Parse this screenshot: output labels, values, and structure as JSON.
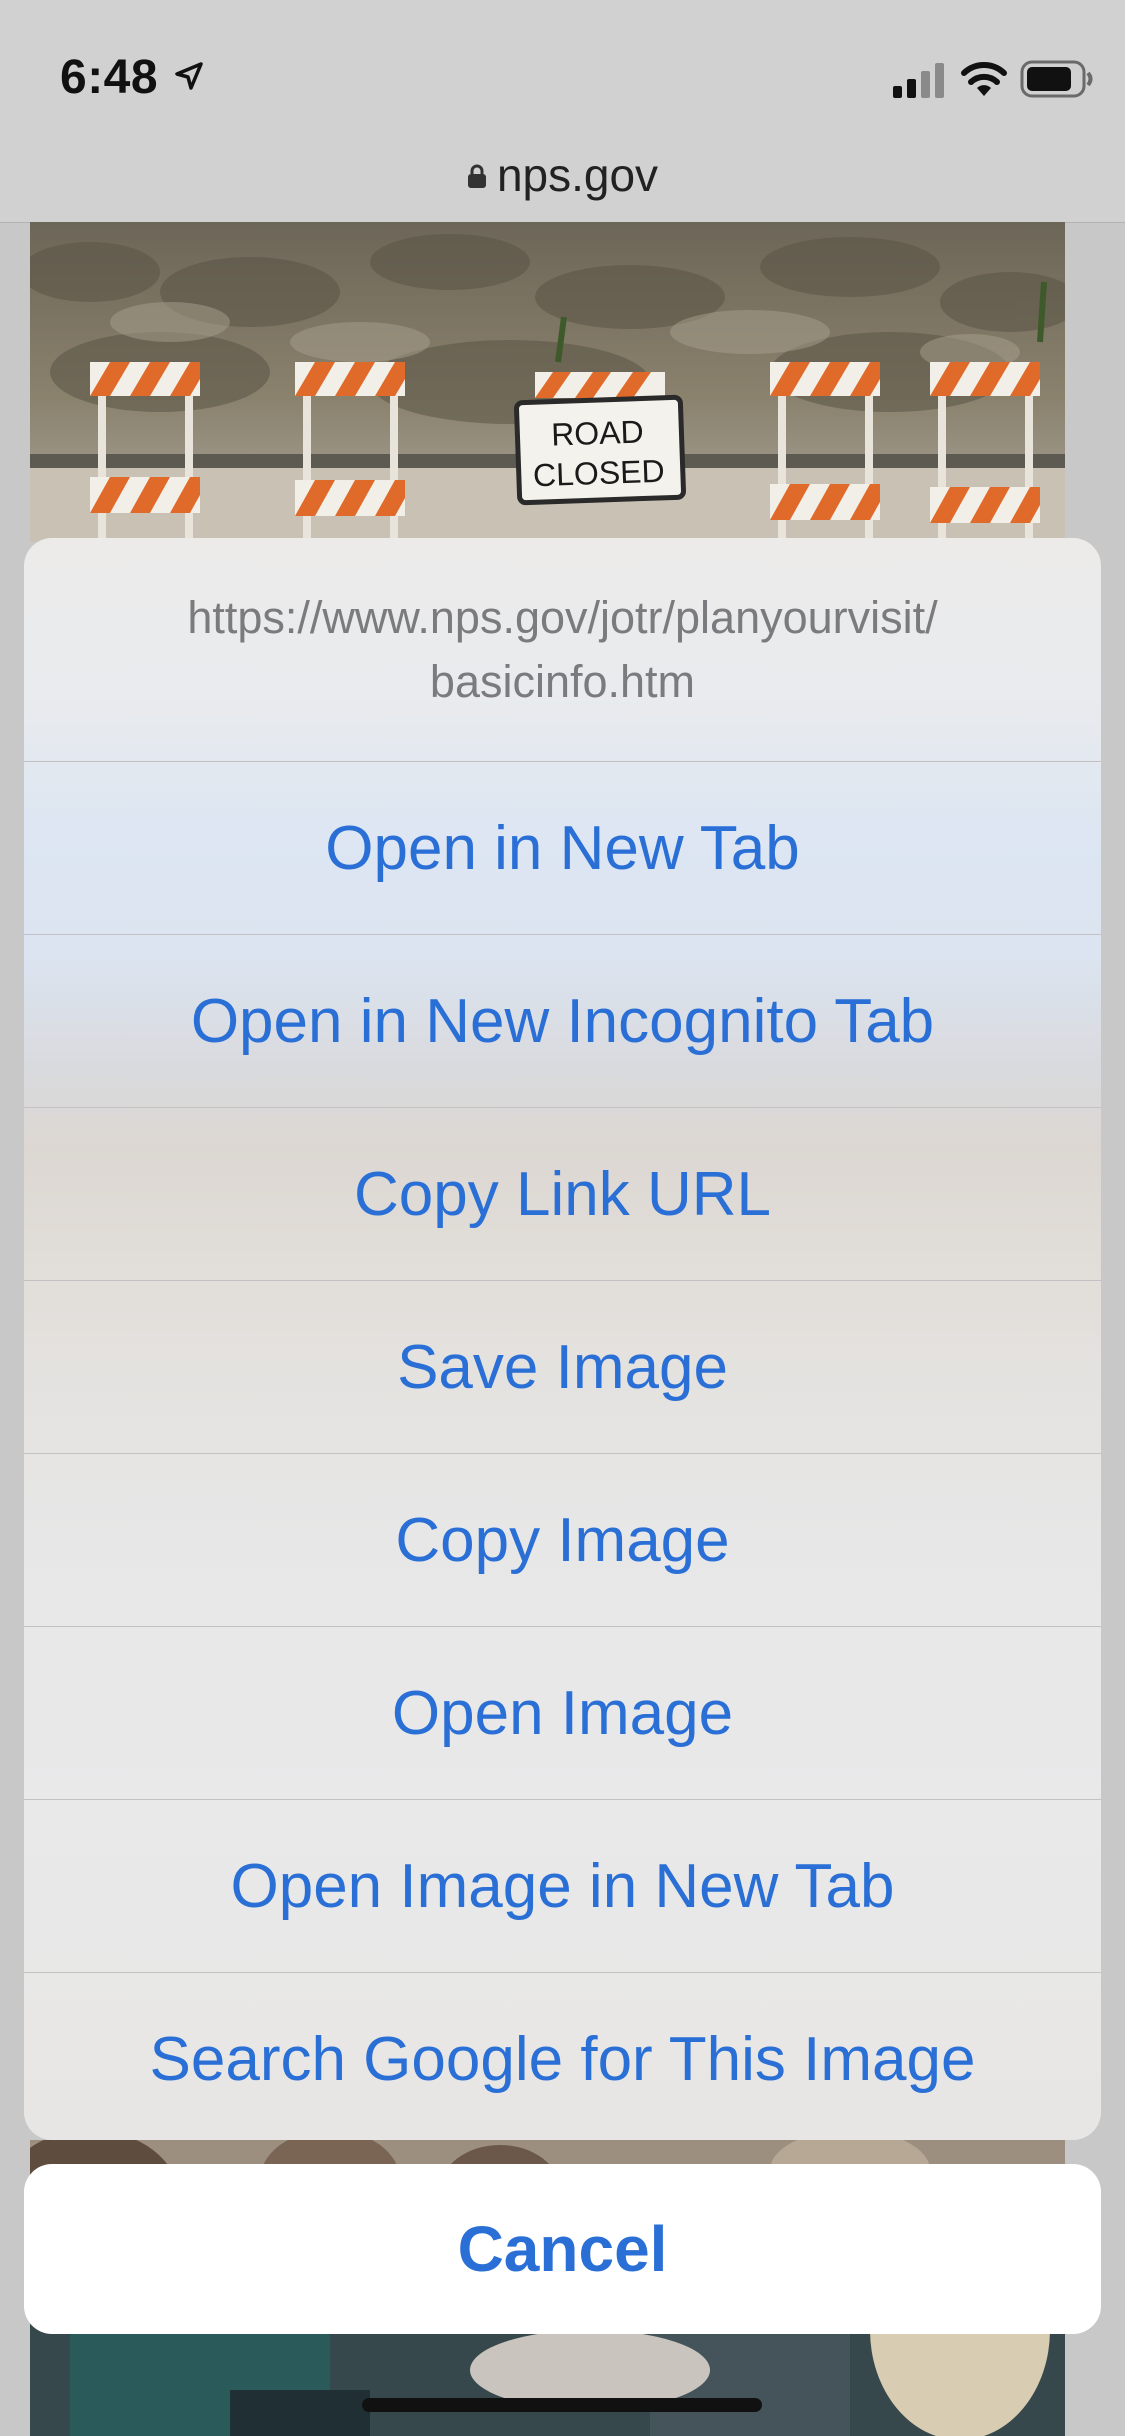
{
  "status_bar": {
    "time": "6:48",
    "icons": [
      "location-arrow-icon",
      "cellular-signal-icon",
      "wifi-icon",
      "battery-icon"
    ]
  },
  "url_bar": {
    "domain": "nps.gov",
    "icon": "lock-icon"
  },
  "page": {
    "sign_line1": "ROAD",
    "sign_line2": "CLOSED"
  },
  "action_sheet": {
    "url_line1": "https://www.nps.gov/jotr/planyourvisit/",
    "url_line2": "basicinfo.htm",
    "items": [
      {
        "label": "Open in New Tab"
      },
      {
        "label": "Open in New Incognito Tab"
      },
      {
        "label": "Copy Link URL"
      },
      {
        "label": "Save Image"
      },
      {
        "label": "Copy Image"
      },
      {
        "label": "Open Image"
      },
      {
        "label": "Open Image in New Tab"
      },
      {
        "label": "Search Google for This Image"
      }
    ],
    "cancel_label": "Cancel"
  },
  "colors": {
    "action_blue": "#2a6fd6",
    "header_gray": "#7b7b7e",
    "chrome_gray": "#d1d1d1"
  }
}
